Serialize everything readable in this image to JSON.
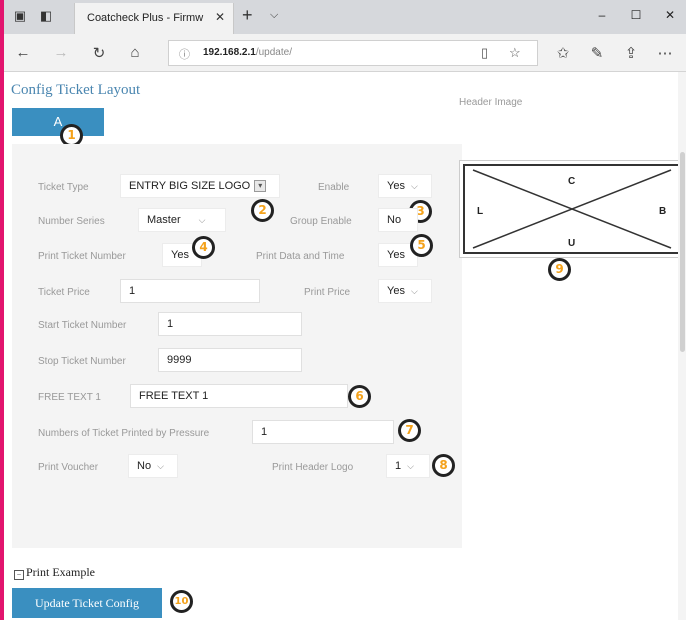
{
  "browser": {
    "tab_title": "Coatcheck Plus - Firmw",
    "tab_close": "✕",
    "new_tab": "+",
    "tab_list": "⌵",
    "min": "–",
    "max": "☐",
    "close": "✕",
    "url_host": "192.168.2.1",
    "url_path": "/update/"
  },
  "page": {
    "title": "Config Ticket Layout",
    "header_image_label": "Header Image",
    "tab_label": "A",
    "print_example": "Print Example",
    "update_button": "Update Ticket Config"
  },
  "form": {
    "ticket_type_label": "Ticket Type",
    "ticket_type_value": "ENTRY BIG SIZE LOGO",
    "enable_label": "Enable",
    "enable_value": "Yes",
    "number_series_label": "Number Series",
    "number_series_value": "Master",
    "group_enable_label": "Group Enable",
    "group_enable_value": "No",
    "print_ticket_number_label": "Print Ticket Number",
    "print_ticket_number_value": "Yes",
    "print_date_time_label": "Print Data and Time",
    "print_date_time_value": "Yes",
    "ticket_price_label": "Ticket Price",
    "ticket_price_value": "1",
    "print_price_label": "Print Price",
    "print_price_value": "Yes",
    "start_ticket_label": "Start Ticket Number",
    "start_ticket_value": "1",
    "stop_ticket_label": "Stop Ticket Number",
    "stop_ticket_value": "9999",
    "free_text_label": "FREE TEXT 1",
    "free_text_value": "FREE TEXT 1",
    "presses_label": "Numbers of Ticket Printed by Pressure",
    "presses_value": "1",
    "print_voucher_label": "Print Voucher",
    "print_voucher_value": "No",
    "print_header_logo_label": "Print Header Logo",
    "print_header_logo_value": "1"
  },
  "header_image": {
    "top": "C",
    "left": "L",
    "right": "B",
    "bottom": "U"
  },
  "badges": [
    "1",
    "2",
    "3",
    "4",
    "5",
    "6",
    "7",
    "8",
    "9",
    "10"
  ],
  "colors": {
    "accent": "#3a8fc0",
    "badge_text": "#f4a21b",
    "frame": "#e2146e"
  }
}
